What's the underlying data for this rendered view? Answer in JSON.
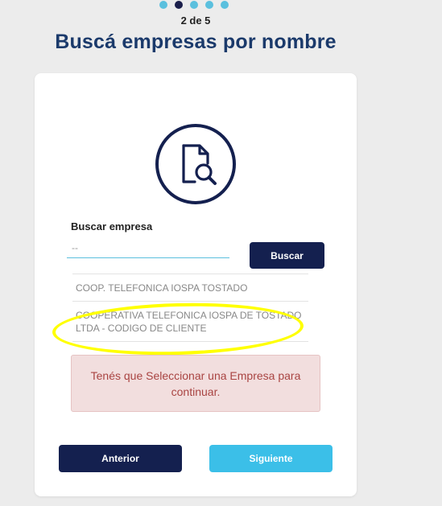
{
  "stepper": {
    "total_steps": 5,
    "current_step": 2,
    "label": "2 de 5"
  },
  "header": {
    "title": "Buscá empresas por nombre"
  },
  "search": {
    "icon": "document-search-icon",
    "label": "Buscar empresa",
    "placeholder": "--",
    "button_label": "Buscar"
  },
  "results": [
    {
      "label": "COOP. TELEFONICA IOSPA TOSTADO"
    },
    {
      "label": "COOPERATIVA TELEFONICA IOSPA DE TOSTADO LTDA - CODIGO DE CLIENTE"
    }
  ],
  "alert": {
    "message": "Tenés que Seleccionar una Empresa para continuar."
  },
  "nav": {
    "prev_label": "Anterior",
    "next_label": "Siguiente"
  },
  "colors": {
    "primary_dark": "#14204f",
    "accent": "#3bbfe8",
    "title": "#1b3a6b",
    "alert_bg": "#f2dede",
    "alert_text": "#a94442",
    "annotation_highlight": "#ffff00"
  }
}
